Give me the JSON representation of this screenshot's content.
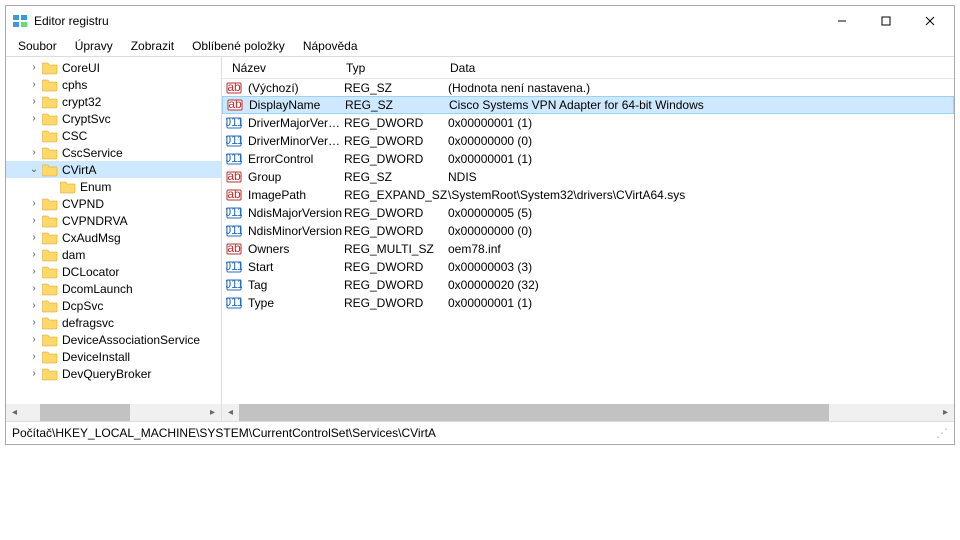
{
  "window": {
    "title": "Editor registru"
  },
  "menu": {
    "items": [
      "Soubor",
      "Úpravy",
      "Zobrazit",
      "Oblíbené položky",
      "Nápověda"
    ]
  },
  "tree": [
    {
      "indent": 1,
      "twisty": ">",
      "label": "CoreUI"
    },
    {
      "indent": 1,
      "twisty": ">",
      "label": "cphs"
    },
    {
      "indent": 1,
      "twisty": ">",
      "label": "crypt32"
    },
    {
      "indent": 1,
      "twisty": ">",
      "label": "CryptSvc"
    },
    {
      "indent": 1,
      "twisty": "",
      "label": "CSC"
    },
    {
      "indent": 1,
      "twisty": ">",
      "label": "CscService"
    },
    {
      "indent": 1,
      "twisty": "v",
      "label": "CVirtA",
      "selected": true
    },
    {
      "indent": 2,
      "twisty": "",
      "label": "Enum"
    },
    {
      "indent": 1,
      "twisty": ">",
      "label": "CVPND"
    },
    {
      "indent": 1,
      "twisty": ">",
      "label": "CVPNDRVA"
    },
    {
      "indent": 1,
      "twisty": ">",
      "label": "CxAudMsg"
    },
    {
      "indent": 1,
      "twisty": ">",
      "label": "dam"
    },
    {
      "indent": 1,
      "twisty": ">",
      "label": "DCLocator"
    },
    {
      "indent": 1,
      "twisty": ">",
      "label": "DcomLaunch"
    },
    {
      "indent": 1,
      "twisty": ">",
      "label": "DcpSvc"
    },
    {
      "indent": 1,
      "twisty": ">",
      "label": "defragsvc"
    },
    {
      "indent": 1,
      "twisty": ">",
      "label": "DeviceAssociationService"
    },
    {
      "indent": 1,
      "twisty": ">",
      "label": "DeviceInstall"
    },
    {
      "indent": 1,
      "twisty": ">",
      "label": "DevQueryBroker"
    }
  ],
  "columns": {
    "name": "Název",
    "type": "Typ",
    "data": "Data"
  },
  "values": [
    {
      "icon": "sz",
      "name": "(Výchozí)",
      "type": "REG_SZ",
      "data": "(Hodnota není nastavena.)"
    },
    {
      "icon": "sz",
      "name": "DisplayName",
      "type": "REG_SZ",
      "data": "Cisco Systems VPN Adapter for 64-bit Windows",
      "selected": true
    },
    {
      "icon": "bin",
      "name": "DriverMajorVers…",
      "type": "REG_DWORD",
      "data": "0x00000001 (1)"
    },
    {
      "icon": "bin",
      "name": "DriverMinorVers…",
      "type": "REG_DWORD",
      "data": "0x00000000 (0)"
    },
    {
      "icon": "bin",
      "name": "ErrorControl",
      "type": "REG_DWORD",
      "data": "0x00000001 (1)"
    },
    {
      "icon": "sz",
      "name": "Group",
      "type": "REG_SZ",
      "data": "NDIS"
    },
    {
      "icon": "sz",
      "name": "ImagePath",
      "type": "REG_EXPAND_SZ",
      "data": "\\SystemRoot\\System32\\drivers\\CVirtA64.sys"
    },
    {
      "icon": "bin",
      "name": "NdisMajorVersion",
      "type": "REG_DWORD",
      "data": "0x00000005 (5)"
    },
    {
      "icon": "bin",
      "name": "NdisMinorVersion",
      "type": "REG_DWORD",
      "data": "0x00000000 (0)"
    },
    {
      "icon": "sz",
      "name": "Owners",
      "type": "REG_MULTI_SZ",
      "data": "oem78.inf"
    },
    {
      "icon": "bin",
      "name": "Start",
      "type": "REG_DWORD",
      "data": "0x00000003 (3)"
    },
    {
      "icon": "bin",
      "name": "Tag",
      "type": "REG_DWORD",
      "data": "0x00000020 (32)"
    },
    {
      "icon": "bin",
      "name": "Type",
      "type": "REG_DWORD",
      "data": "0x00000001 (1)"
    }
  ],
  "statusbar": {
    "path": "Počítač\\HKEY_LOCAL_MACHINE\\SYSTEM\\CurrentControlSet\\Services\\CVirtA"
  }
}
